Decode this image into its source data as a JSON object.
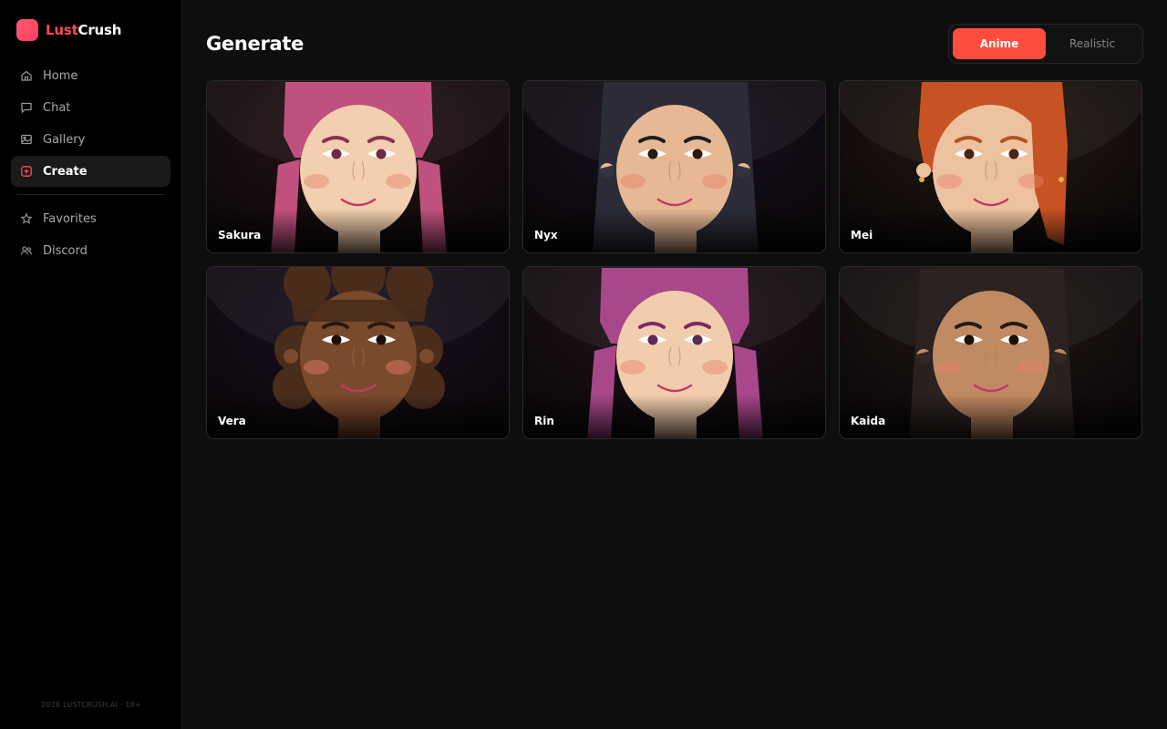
{
  "brand": {
    "name_a": "Lust",
    "name_b": "Crush"
  },
  "nav": [
    {
      "label": "Home",
      "icon": "home-icon"
    },
    {
      "label": "Chat",
      "icon": "chat-icon"
    },
    {
      "label": "Gallery",
      "icon": "gallery-icon"
    },
    {
      "label": "Create",
      "icon": "create-icon",
      "active": true
    }
  ],
  "nav_secondary": [
    {
      "label": "Favorites",
      "icon": "star-icon"
    },
    {
      "label": "Discord",
      "icon": "users-icon"
    }
  ],
  "footer": "2026 LUSTCRUSH.AI · 18+",
  "page": {
    "title": "Generate"
  },
  "style_toggle": {
    "options": [
      "Anime",
      "Realistic"
    ],
    "selected": "Anime"
  },
  "characters": [
    {
      "name": "Sakura",
      "skin": "#f2cfae",
      "hair": "#c0507e",
      "hair_style": "pigtails",
      "eye": "#6b2a45",
      "brow": "#8b2f55",
      "bg": "#271317",
      "earrings": false
    },
    {
      "name": "Nyx",
      "skin": "#e6b894",
      "hair": "#2b2c38",
      "hair_style": "long",
      "eye": "#2a1a12",
      "brow": "#1c1c22",
      "bg": "#161020",
      "earrings": false
    },
    {
      "name": "Mei",
      "skin": "#edc29e",
      "hair": "#c75224",
      "hair_style": "side",
      "eye": "#4a2414",
      "brow": "#b84e22",
      "bg": "#241810",
      "earrings": true
    },
    {
      "name": "Vera",
      "skin": "#7a4a2c",
      "hair": "#4a2c1a",
      "hair_style": "curly",
      "eye": "#1a0e08",
      "brow": "#2a1a10",
      "bg": "#1a1024",
      "earrings": false
    },
    {
      "name": "Rin",
      "skin": "#f2cdad",
      "hair": "#a8488a",
      "hair_style": "pigtails",
      "eye": "#5a2a55",
      "brow": "#7b2a65",
      "bg": "#22131c",
      "earrings": false
    },
    {
      "name": "Kaida",
      "skin": "#c08a62",
      "hair": "#2a2220",
      "hair_style": "long",
      "eye": "#1a0e08",
      "brow": "#241a16",
      "bg": "#201614",
      "earrings": false
    }
  ]
}
